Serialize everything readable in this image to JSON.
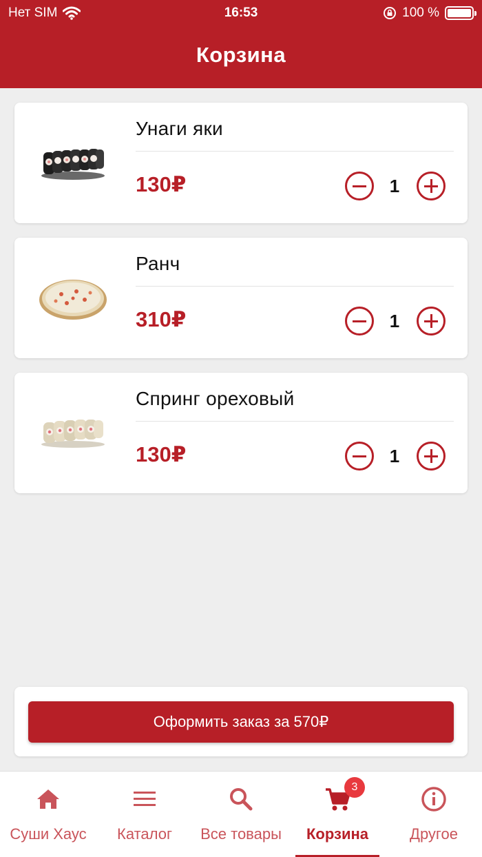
{
  "status_bar": {
    "carrier": "Нет SIM",
    "time": "16:53",
    "battery": "100 %"
  },
  "header": {
    "title": "Корзина"
  },
  "cart": {
    "items": [
      {
        "name": "Унаги яки",
        "price": "130₽",
        "quantity": "1",
        "image": "sushi-roll-dark"
      },
      {
        "name": "Ранч",
        "price": "310₽",
        "quantity": "1",
        "image": "pizza"
      },
      {
        "name": "Спринг ореховый",
        "price": "130₽",
        "quantity": "1",
        "image": "sushi-roll-light"
      }
    ]
  },
  "order": {
    "button_label": "Оформить заказ за 570₽"
  },
  "tabbar": {
    "tabs": [
      {
        "label": "Суши Хаус",
        "icon": "home-icon"
      },
      {
        "label": "Каталог",
        "icon": "menu-icon"
      },
      {
        "label": "Все товары",
        "icon": "search-icon"
      },
      {
        "label": "Корзина",
        "icon": "cart-icon",
        "badge": "3",
        "active": true
      },
      {
        "label": "Другое",
        "icon": "info-icon"
      }
    ]
  },
  "colors": {
    "brand": "#b71f27",
    "badge": "#e8393e",
    "inactive_tab": "#c9545a",
    "background": "#eeeeee"
  }
}
